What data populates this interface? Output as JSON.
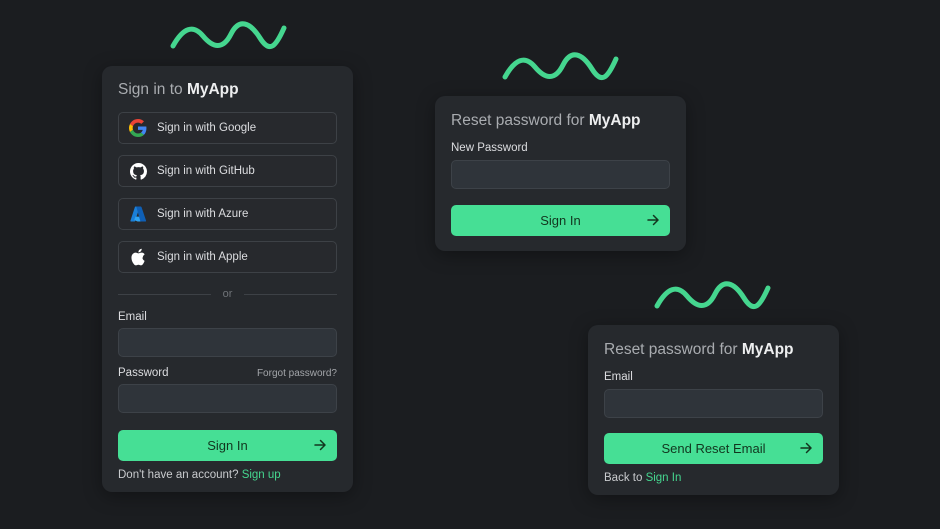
{
  "colors": {
    "background": "#1b1d20",
    "card": "#26292d",
    "accent": "#46df95",
    "link": "#45d68f"
  },
  "signin_card": {
    "title_prefix": "Sign in to",
    "title_app": "MyApp",
    "providers": [
      {
        "label": "Sign in with Google",
        "icon": "google-icon"
      },
      {
        "label": "Sign in with GitHub",
        "icon": "github-icon"
      },
      {
        "label": "Sign in with Azure",
        "icon": "azure-icon"
      },
      {
        "label": "Sign in with Apple",
        "icon": "apple-icon"
      }
    ],
    "divider_text": "or",
    "email_label": "Email",
    "email_value": "",
    "email_placeholder": "",
    "password_label": "Password",
    "password_value": "",
    "password_placeholder": "",
    "forgot_password": "Forgot password?",
    "submit_label": "Sign In",
    "submit_icon": "arrow-right-icon",
    "footer_prefix": "Don't have an account?",
    "footer_link": "Sign up"
  },
  "reset_new_password_card": {
    "title_prefix": "Reset password for",
    "title_app": "MyApp",
    "new_password_label": "New Password",
    "new_password_value": "",
    "new_password_placeholder": "",
    "submit_label": "Sign In",
    "submit_icon": "arrow-right-icon"
  },
  "reset_email_card": {
    "title_prefix": "Reset password for",
    "title_app": "MyApp",
    "email_label": "Email",
    "email_value": "",
    "email_placeholder": "",
    "submit_label": "Send Reset Email",
    "submit_icon": "arrow-right-icon",
    "footer_prefix": "Back to",
    "footer_link": "Sign In"
  },
  "decorations": {
    "wave_icon": "squiggle-wave-icon"
  }
}
